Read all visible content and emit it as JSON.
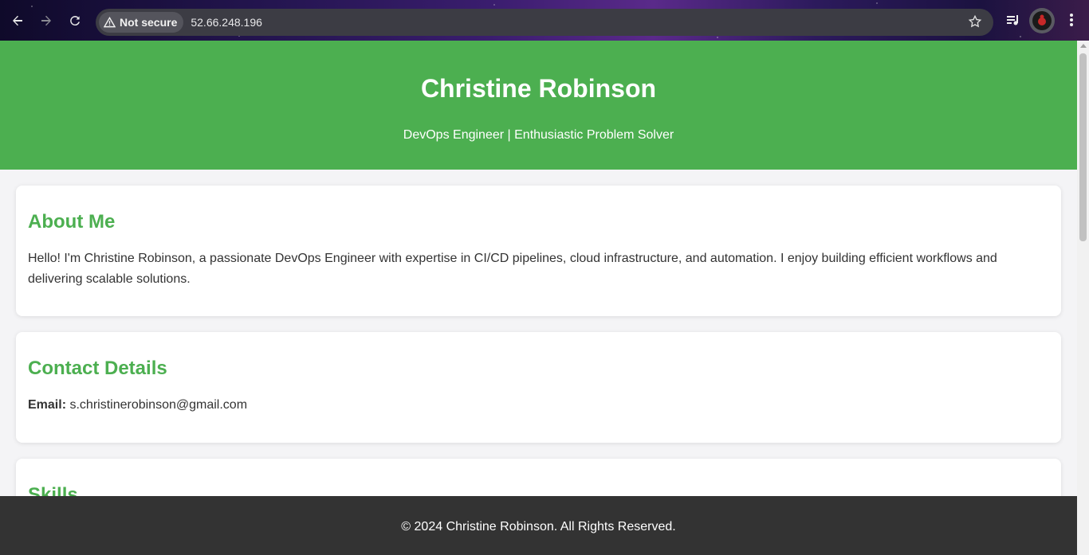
{
  "browser": {
    "security_label": "Not secure",
    "url": "52.66.248.196",
    "icons": [
      "back-arrow-icon",
      "forward-arrow-icon",
      "reload-icon",
      "warning-triangle-icon",
      "star-icon",
      "media-controls-icon",
      "profile-avatar-icon",
      "kebab-menu-icon"
    ]
  },
  "hero": {
    "name": "Christine Robinson",
    "tagline": "DevOps Engineer | Enthusiastic Problem Solver"
  },
  "about": {
    "heading": "About Me",
    "body": "Hello! I'm Christine Robinson, a passionate DevOps Engineer with expertise in CI/CD pipelines, cloud infrastructure, and automation. I enjoy building efficient workflows and delivering scalable solutions."
  },
  "contact": {
    "heading": "Contact Details",
    "email_label": "Email:",
    "email_value": "s.christinerobinson@gmail.com"
  },
  "skills": {
    "heading": "Skills"
  },
  "footer": {
    "text": "© 2024 Christine Robinson. All Rights Reserved."
  },
  "colors": {
    "accent": "#4caf50",
    "footer_bg": "#333333",
    "body_text": "#333333"
  }
}
